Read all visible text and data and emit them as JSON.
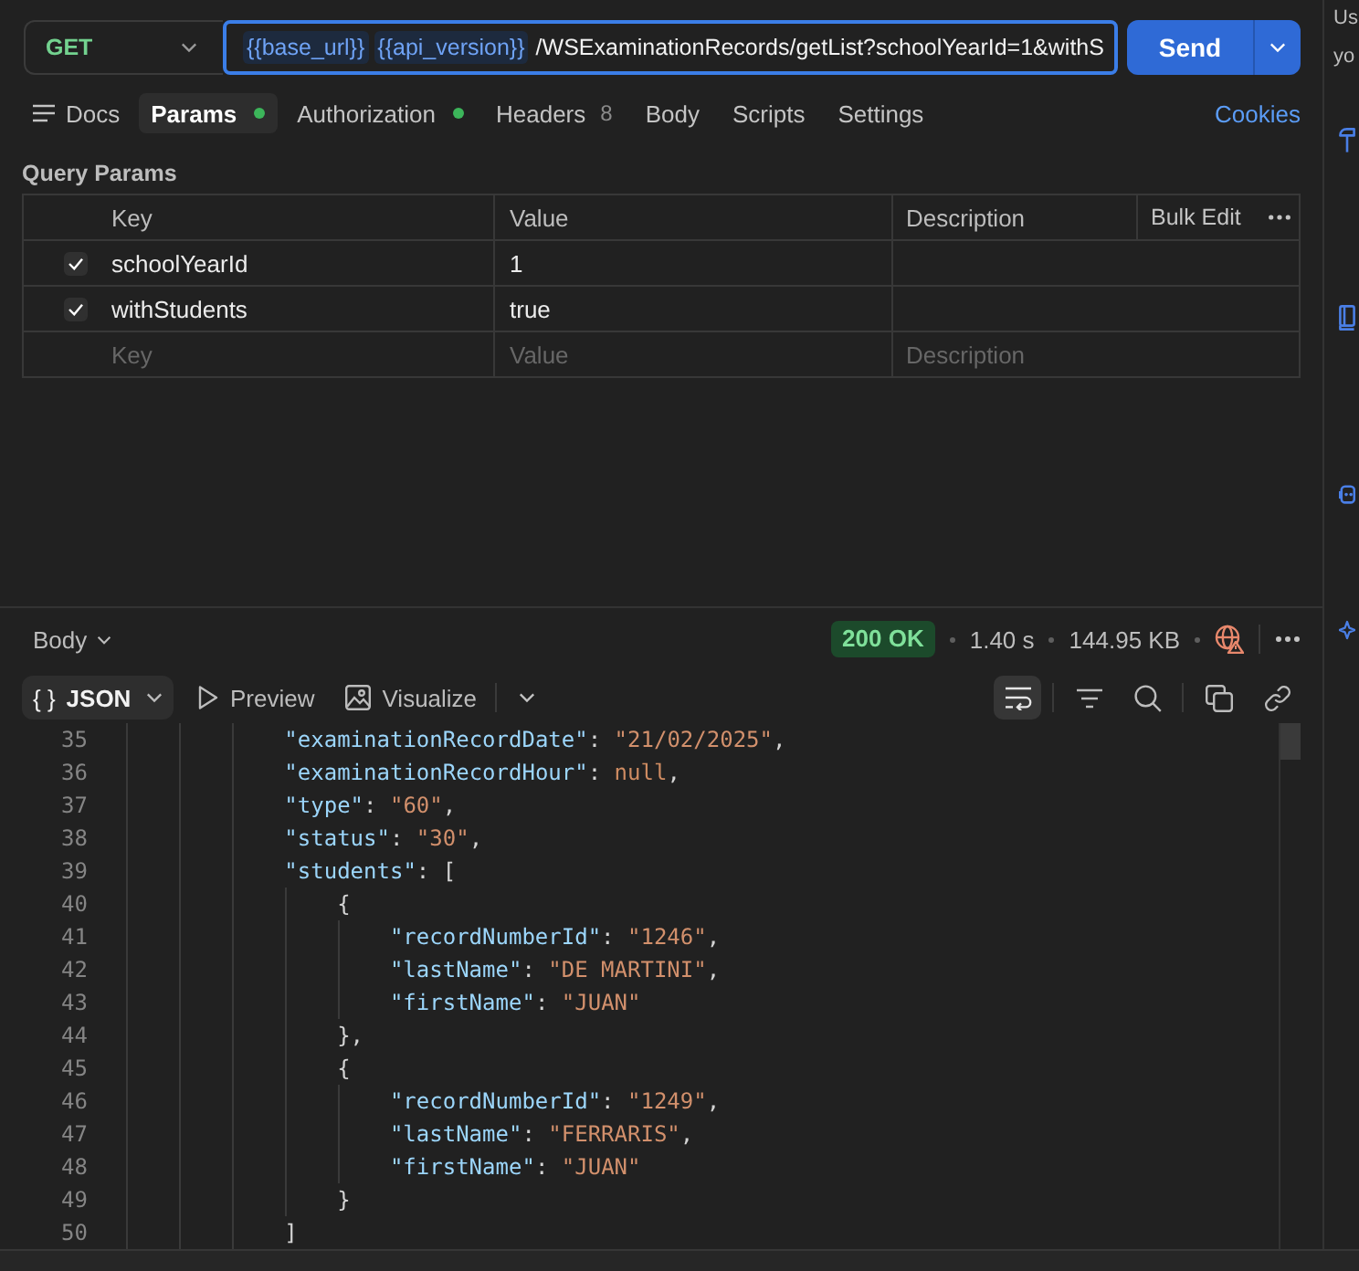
{
  "request": {
    "method": "GET",
    "url": {
      "focused": true,
      "variables": [
        "{{base_url}}",
        "{{api_version}}"
      ],
      "path": "/WSExaminationRecords/getList?schoolYearId=1&withS"
    },
    "send": "Send"
  },
  "docs": {
    "label": "Docs"
  },
  "request_tabs": [
    {
      "label": "Params",
      "selected": true,
      "dot": true
    },
    {
      "label": "Authorization",
      "selected": false,
      "dot": true
    },
    {
      "label": "Headers",
      "selected": false,
      "dot": false,
      "count": "8"
    },
    {
      "label": "Body",
      "selected": false,
      "dot": false
    },
    {
      "label": "Scripts",
      "selected": false,
      "dot": false
    },
    {
      "label": "Settings",
      "selected": false,
      "dot": false
    }
  ],
  "cookies": "Cookies",
  "query_params": {
    "title": "Query Params",
    "columns": [
      "Key",
      "Value",
      "Description"
    ],
    "bulk_edit": "Bulk Edit",
    "rows": [
      {
        "enabled": true,
        "key": "schoolYearId",
        "value": "1"
      },
      {
        "enabled": true,
        "key": "withStudents",
        "value": "true"
      }
    ],
    "new_row": {
      "key": {
        "placeholder": "Key"
      },
      "value": {
        "placeholder": "Value"
      },
      "description": {
        "placeholder": "Description"
      }
    }
  },
  "response": {
    "section": "Body",
    "status": "200 OK",
    "time": "1.40 s",
    "size": "144.95 KB",
    "format": {
      "icon_text": "{ }",
      "label": "JSON"
    },
    "views": [
      {
        "kind": "preview",
        "label": "Preview"
      },
      {
        "kind": "visualize",
        "label": "Visualize"
      }
    ],
    "tool_groups": [
      {
        "tools": [
          {
            "kind": "wrap",
            "on": true
          }
        ]
      },
      {
        "tools": [
          {
            "kind": "filter",
            "on": false
          },
          {
            "kind": "search",
            "on": false
          }
        ]
      },
      {
        "tools": [
          {
            "kind": "copy",
            "on": false
          },
          {
            "kind": "link",
            "on": false
          }
        ]
      }
    ]
  },
  "code_lines": [
    {
      "number": "35",
      "tokens": [
        {
          "kind": "key",
          "text": "\"examinationRecordDate\""
        },
        {
          "kind": "punct",
          "text": ": "
        },
        {
          "kind": "string",
          "text": "\"21/02/2025\""
        },
        {
          "kind": "punct",
          "text": ","
        }
      ]
    },
    {
      "number": "36",
      "tokens": [
        {
          "kind": "key",
          "text": "\"examinationRecordHour\""
        },
        {
          "kind": "punct",
          "text": ": "
        },
        {
          "kind": "null",
          "text": "null"
        },
        {
          "kind": "punct",
          "text": ","
        }
      ]
    },
    {
      "number": "37",
      "tokens": [
        {
          "kind": "key",
          "text": "\"type\""
        },
        {
          "kind": "punct",
          "text": ": "
        },
        {
          "kind": "string",
          "text": "\"60\""
        },
        {
          "kind": "punct",
          "text": ","
        }
      ]
    },
    {
      "number": "38",
      "tokens": [
        {
          "kind": "key",
          "text": "\"status\""
        },
        {
          "kind": "punct",
          "text": ": "
        },
        {
          "kind": "string",
          "text": "\"30\""
        },
        {
          "kind": "punct",
          "text": ","
        }
      ]
    },
    {
      "number": "39",
      "tokens": [
        {
          "kind": "key",
          "text": "\"students\""
        },
        {
          "kind": "punct",
          "text": ": ["
        }
      ],
      "children": [
        {
          "number": "40",
          "tokens": [
            {
              "kind": "punct",
              "text": "{"
            }
          ],
          "children": [
            {
              "number": "41",
              "tokens": [
                {
                  "kind": "key",
                  "text": "\"recordNumberId\""
                },
                {
                  "kind": "punct",
                  "text": ": "
                },
                {
                  "kind": "string",
                  "text": "\"1246\""
                },
                {
                  "kind": "punct",
                  "text": ","
                }
              ]
            },
            {
              "number": "42",
              "tokens": [
                {
                  "kind": "key",
                  "text": "\"lastName\""
                },
                {
                  "kind": "punct",
                  "text": ": "
                },
                {
                  "kind": "string",
                  "text": "\"DE MARTINI\""
                },
                {
                  "kind": "punct",
                  "text": ","
                }
              ]
            },
            {
              "number": "43",
              "tokens": [
                {
                  "kind": "key",
                  "text": "\"firstName\""
                },
                {
                  "kind": "punct",
                  "text": ": "
                },
                {
                  "kind": "string",
                  "text": "\"JUAN\""
                }
              ]
            }
          ]
        },
        {
          "number": "44",
          "tokens": [
            {
              "kind": "punct",
              "text": "},"
            }
          ]
        },
        {
          "number": "45",
          "tokens": [
            {
              "kind": "punct",
              "text": "{"
            }
          ],
          "children": [
            {
              "number": "46",
              "tokens": [
                {
                  "kind": "key",
                  "text": "\"recordNumberId\""
                },
                {
                  "kind": "punct",
                  "text": ": "
                },
                {
                  "kind": "string",
                  "text": "\"1249\""
                },
                {
                  "kind": "punct",
                  "text": ","
                }
              ]
            },
            {
              "number": "47",
              "tokens": [
                {
                  "kind": "key",
                  "text": "\"lastName\""
                },
                {
                  "kind": "punct",
                  "text": ": "
                },
                {
                  "kind": "string",
                  "text": "\"FERRARIS\""
                },
                {
                  "kind": "punct",
                  "text": ","
                }
              ]
            },
            {
              "number": "48",
              "tokens": [
                {
                  "kind": "key",
                  "text": "\"firstName\""
                },
                {
                  "kind": "punct",
                  "text": ": "
                },
                {
                  "kind": "string",
                  "text": "\"JUAN\""
                }
              ]
            }
          ]
        },
        {
          "number": "49",
          "tokens": [
            {
              "kind": "punct",
              "text": "}"
            }
          ]
        }
      ]
    },
    {
      "number": "50",
      "tokens": [
        {
          "kind": "punct",
          "text": "]"
        }
      ]
    }
  ],
  "sidebar": {
    "text_lines": [
      "Us",
      "yo"
    ]
  }
}
